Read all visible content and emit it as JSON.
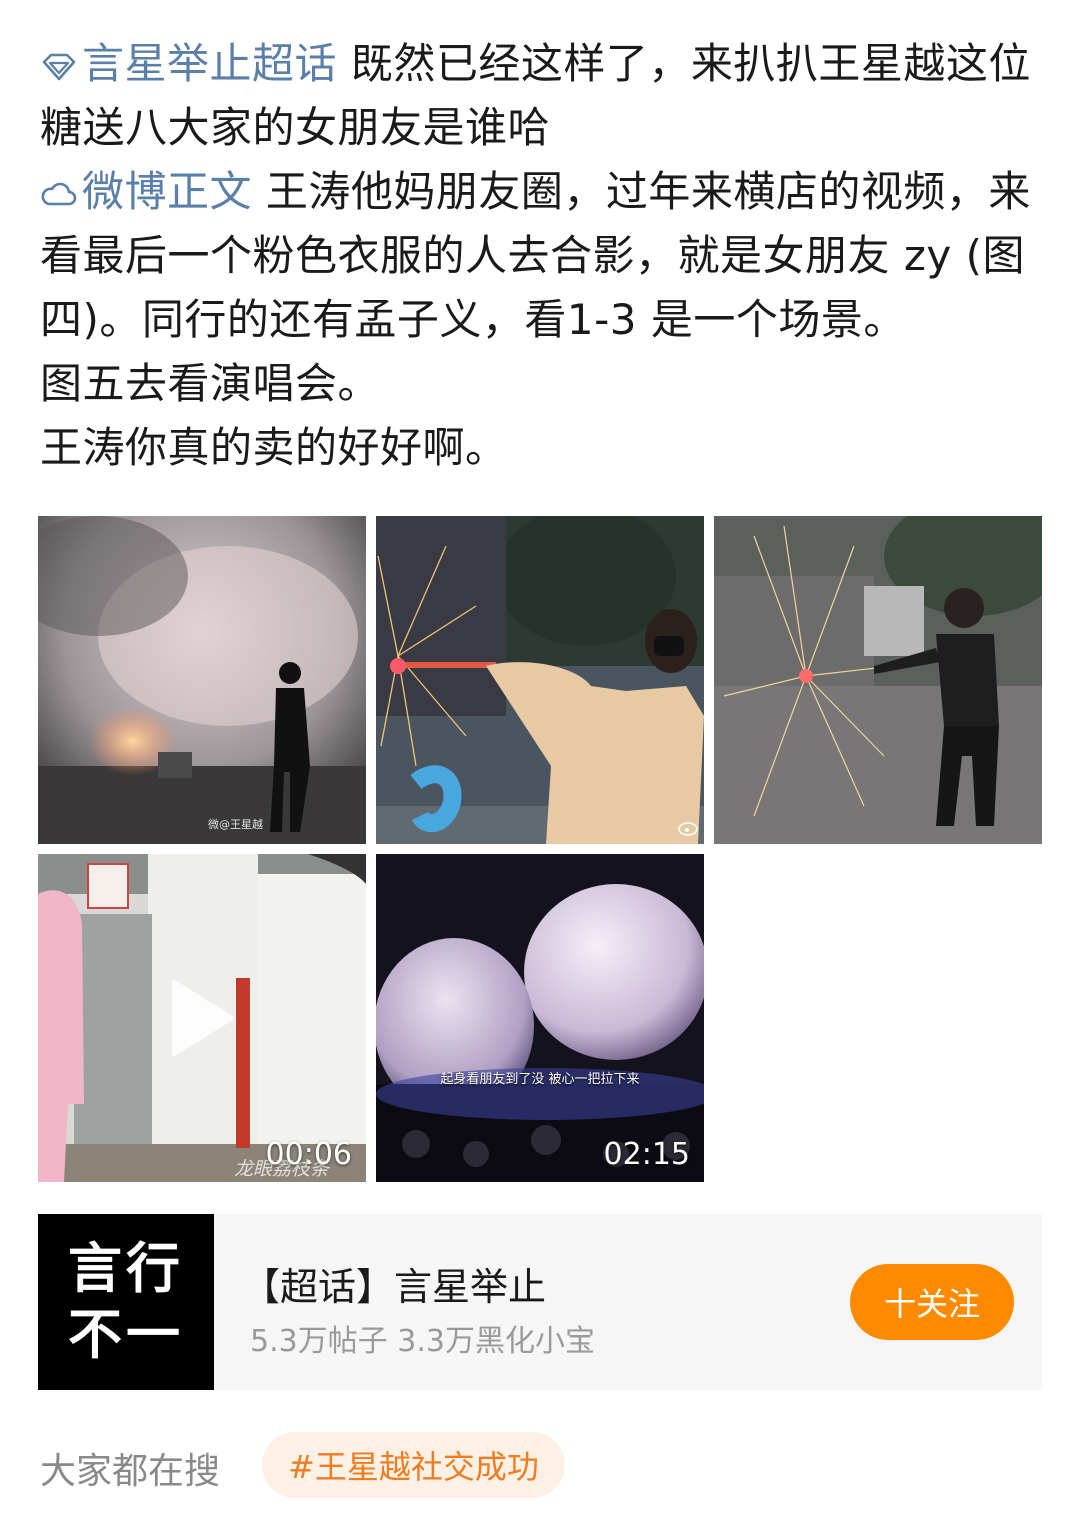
{
  "post": {
    "topic1": "言星举止超话",
    "line1_rest": " 既然已经这样了，来扒扒王星越这位糖送八大家的女朋友是谁哈",
    "topic2": "微博正文",
    "body_part1": " 王涛他妈朋友圈，过年来横店的视频，来看最后一个粉色衣服的人去合影，就是女朋友 zy (图四)。同行的还有孟子义，看1-3 是一个场景。",
    "body_line2": "图五去看演唱会。",
    "body_line3": "王涛你真的卖的好好啊。"
  },
  "media": {
    "tile1_watermark": "微@王星越",
    "tile4_duration": "00:06",
    "tile4_caption": "龙眼荔枝条",
    "tile5_subtitle": "起身看朋友到了没 被心一把拉下来",
    "tile5_duration": "02:15"
  },
  "supertopic_card": {
    "cover_line1": "言行",
    "cover_line2": "不一",
    "title": "【超话】言星举止",
    "stats": "5.3万帖子 3.3万黑化小宝",
    "follow_label": "十关注"
  },
  "search": {
    "label": "大家都在搜",
    "tag": "#王星越社交成功"
  },
  "colors": {
    "link": "#5a7fa8",
    "accent_orange": "#ff8a00",
    "chip_bg": "#fdf1e6",
    "chip_text": "#f07c1f"
  }
}
